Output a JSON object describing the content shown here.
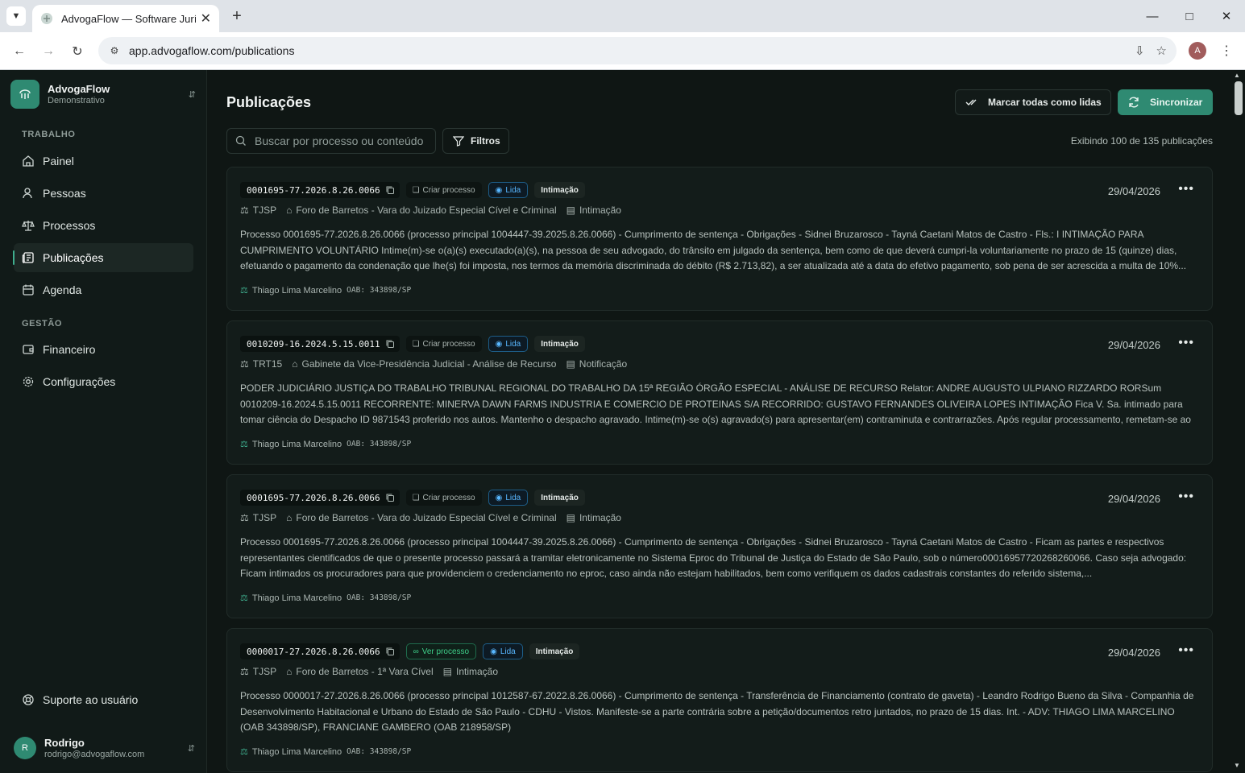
{
  "browser": {
    "tab_title": "AdvogaFlow — Software Jurídico",
    "url": "app.advogaflow.com/publications",
    "profile_initial": "A"
  },
  "sidebar": {
    "brand_name": "AdvogaFlow",
    "brand_sub": "Demonstrativo",
    "section_work": "TRABALHO",
    "section_mgmt": "GESTÃO",
    "items": [
      {
        "label": "Painel",
        "icon": "home-icon"
      },
      {
        "label": "Pessoas",
        "icon": "user-icon"
      },
      {
        "label": "Processos",
        "icon": "scale-icon"
      },
      {
        "label": "Publicações",
        "icon": "newspaper-icon"
      },
      {
        "label": "Agenda",
        "icon": "calendar-icon"
      },
      {
        "label": "Financeiro",
        "icon": "wallet-icon"
      },
      {
        "label": "Configurações",
        "icon": "gear-icon"
      }
    ],
    "support": "Suporte ao usuário",
    "user_initial": "R",
    "user_name": "Rodrigo",
    "user_email": "rodrigo@advogaflow.com"
  },
  "main": {
    "title": "Publicações",
    "mark_all": "Marcar todas como lidas",
    "sync": "Sincronizar",
    "search_placeholder": "Buscar por processo ou conteúdo",
    "filters": "Filtros",
    "count": "Exibindo 100 de 135 publicações"
  },
  "cards": [
    {
      "number": "0001695-77.2026.8.26.0066",
      "action": "Criar processo",
      "status": "Lida",
      "type": "Intimação",
      "date": "29/04/2026",
      "court": "TJSP",
      "venue": "Foro de Barretos - Vara do Juizado Especial Cível e Criminal",
      "kind": "Intimação",
      "text": "Processo 0001695-77.2026.8.26.0066 (processo principal 1004447-39.2025.8.26.0066) - Cumprimento de sentença - Obrigações - Sidnei Bruzarosco - Tayná Caetani Matos de Castro - Fls.: I INTIMAÇÃO PARA CUMPRIMENTO VOLUNTÁRIO Intime(m)-se o(a)(s) executado(a)(s), na pessoa de seu advogado, do trânsito em julgado da sentença, bem como de que deverá cumpri-la voluntariamente no prazo de 15 (quinze) dias, efetuando o pagamento da condenação que lhe(s) foi imposta, nos termos da memória discriminada do débito (R$ 2.713,82), a ser atualizada até a data do efetivo pagamento, sob pena de ser acrescida a multa de 10%...",
      "lawyer": "Thiago Lima Marcelino",
      "oab": "OAB: 343898/SP"
    },
    {
      "number": "0010209-16.2024.5.15.0011",
      "action": "Criar processo",
      "status": "Lida",
      "type": "Intimação",
      "date": "29/04/2026",
      "court": "TRT15",
      "venue": "Gabinete da Vice-Presidência Judicial - Análise de Recurso",
      "kind": "Notificação",
      "text": "PODER JUDICIÁRIO JUSTIÇA DO TRABALHO TRIBUNAL REGIONAL DO TRABALHO DA 15ª REGIÃO ÓRGÃO ESPECIAL - ANÁLISE DE RECURSO Relator: ANDRE AUGUSTO ULPIANO RIZZARDO RORSum 0010209-16.2024.5.15.0011 RECORRENTE: MINERVA DAWN FARMS INDUSTRIA E COMERCIO DE PROTEINAS S/A RECORRIDO: GUSTAVO FERNANDES OLIVEIRA LOPES INTIMAÇÃO Fica V. Sa. intimado para tomar ciência do Despacho ID 9871543 proferido nos autos. Mantenho o despacho agravado. Intime(m)-se o(s) agravado(s) para apresentar(em) contraminuta e contrarrazões. Após regular processamento, remetam-se ao C. Tribunal...",
      "lawyer": "Thiago Lima Marcelino",
      "oab": "OAB: 343898/SP"
    },
    {
      "number": "0001695-77.2026.8.26.0066",
      "action": "Criar processo",
      "status": "Lida",
      "type": "Intimação",
      "date": "29/04/2026",
      "court": "TJSP",
      "venue": "Foro de Barretos - Vara do Juizado Especial Cível e Criminal",
      "kind": "Intimação",
      "text": "Processo 0001695-77.2026.8.26.0066 (processo principal 1004447-39.2025.8.26.0066) - Cumprimento de sentença - Obrigações - Sidnei Bruzarosco - Tayná Caetani Matos de Castro - Ficam as partes e respectivos representantes cientificados de que o presente processo passará a tramitar eletronicamente no Sistema Eproc do Tribunal de Justiça do Estado de São Paulo, sob o número00016957720268260066. Caso seja advogado: Ficam intimados os procuradores para que providenciem o credenciamento no eproc, caso ainda não estejam habilitados, bem como verifiquem os dados cadastrais constantes do referido sistema,...",
      "lawyer": "Thiago Lima Marcelino",
      "oab": "OAB: 343898/SP"
    },
    {
      "number": "0000017-27.2026.8.26.0066",
      "action": "Ver processo",
      "status": "Lida",
      "type": "Intimação",
      "date": "29/04/2026",
      "court": "TJSP",
      "venue": "Foro de Barretos - 1ª Vara Cível",
      "kind": "Intimação",
      "text": "Processo 0000017-27.2026.8.26.0066 (processo principal 1012587-67.2022.8.26.0066) - Cumprimento de sentença - Transferência de Financiamento (contrato de gaveta) - Leandro Rodrigo Bueno da Silva - Companhia de Desenvolvimento Habitacional e Urbano do Estado de São Paulo - CDHU - Vistos. Manifeste-se a parte contrária sobre a petição/documentos retro juntados, no prazo de 15 dias. Int. - ADV: THIAGO LIMA MARCELINO (OAB 343898/SP), FRANCIANE GAMBERO (OAB 218958/SP)",
      "lawyer": "Thiago Lima Marcelino",
      "oab": "OAB: 343898/SP"
    }
  ]
}
